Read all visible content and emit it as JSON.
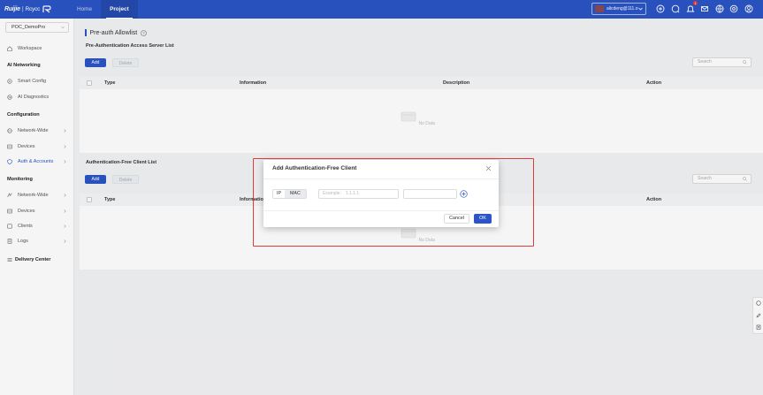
{
  "brand": {
    "name": "Ruijie",
    "separator": "|",
    "sub": "Rcycc"
  },
  "topnav": [
    {
      "label": "Home",
      "active": false
    },
    {
      "label": "Project",
      "active": true
    }
  ],
  "account": {
    "label": "alicdeng@111.o..."
  },
  "notifications": {
    "count": "1"
  },
  "sidebar": {
    "project": "POC_DemoPro",
    "workspace": "Workspace",
    "sections": [
      {
        "heading": "AI Networking",
        "items": [
          {
            "label": "Smart Config",
            "icon": "gear-sparkle-icon"
          },
          {
            "label": "AI Diagnostics",
            "icon": "diagnostics-icon"
          }
        ]
      },
      {
        "heading": "Configuration",
        "items": [
          {
            "label": "Network-Wide",
            "icon": "globe-icon"
          },
          {
            "label": "Devices",
            "icon": "device-icon"
          },
          {
            "label": "Auth & Accounts",
            "icon": "shield-icon",
            "active": true
          }
        ]
      },
      {
        "heading": "Monitoring",
        "items": [
          {
            "label": "Network-Wide",
            "icon": "chart-icon"
          },
          {
            "label": "Devices",
            "icon": "device-icon"
          },
          {
            "label": "Clients",
            "icon": "client-icon"
          },
          {
            "label": "Logs",
            "icon": "log-icon"
          }
        ]
      }
    ],
    "delivery": "Delivery Center"
  },
  "page": {
    "title": "Pre-auth Allowlist",
    "server_list": {
      "label": "Pre-Authentication Access Server List",
      "add": "Add",
      "delete": "Delete",
      "search_placeholder": "Search",
      "columns": [
        "Type",
        "Information",
        "Description",
        "Action"
      ],
      "empty": "No Data"
    },
    "client_list": {
      "label": "Authentication-Free Client List",
      "add": "Add",
      "delete": "Delete",
      "search_placeholder": "Search",
      "columns": [
        "Type",
        "Information",
        "Action"
      ],
      "empty": "No Data"
    }
  },
  "dialog": {
    "title": "Add Authentication-Free Client",
    "segments": [
      "IP",
      "MAC"
    ],
    "ip_placeholder": "Example： 1.1.1.1",
    "second_value": "",
    "cancel": "Cancel",
    "ok": "OK"
  },
  "colors": {
    "primary": "#2b55c6",
    "highlight": "#e53935"
  }
}
